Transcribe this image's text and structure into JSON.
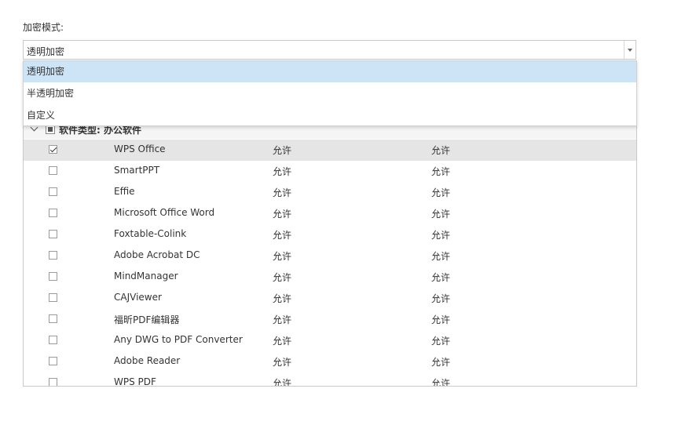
{
  "form": {
    "mode_label": "加密模式:",
    "selected_value": "透明加密",
    "options": [
      {
        "label": "透明加密",
        "selected": true
      },
      {
        "label": "半透明加密",
        "selected": false
      },
      {
        "label": "自定义",
        "selected": false
      }
    ]
  },
  "table": {
    "group_title": "软件类型: 办公软件",
    "rows": [
      {
        "name": "WPS Office",
        "perm1": "允许",
        "perm2": "允许",
        "checked": true,
        "highlighted": true
      },
      {
        "name": "SmartPPT",
        "perm1": "允许",
        "perm2": "允许",
        "checked": false
      },
      {
        "name": "Effie",
        "perm1": "允许",
        "perm2": "允许",
        "checked": false
      },
      {
        "name": "Microsoft Office Word",
        "perm1": "允许",
        "perm2": "允许",
        "checked": false
      },
      {
        "name": "Foxtable-Colink",
        "perm1": "允许",
        "perm2": "允许",
        "checked": false
      },
      {
        "name": "Adobe Acrobat DC",
        "perm1": "允许",
        "perm2": "允许",
        "checked": false
      },
      {
        "name": "MindManager",
        "perm1": "允许",
        "perm2": "允许",
        "checked": false
      },
      {
        "name": "CAJViewer",
        "perm1": "允许",
        "perm2": "允许",
        "checked": false
      },
      {
        "name": "福昕PDF编辑器",
        "perm1": "允许",
        "perm2": "允许",
        "checked": false
      },
      {
        "name": "Any DWG to PDF Converter",
        "perm1": "允许",
        "perm2": "允许",
        "checked": false
      },
      {
        "name": "Adobe Reader",
        "perm1": "允许",
        "perm2": "允许",
        "checked": false
      },
      {
        "name": "WPS PDF",
        "perm1": "允许",
        "perm2": "允许",
        "checked": false
      }
    ]
  },
  "colors": {
    "selected_option_bg": "#cde4f6",
    "highlighted_row_bg": "#e5e5e5",
    "border": "#c8c8c8"
  }
}
